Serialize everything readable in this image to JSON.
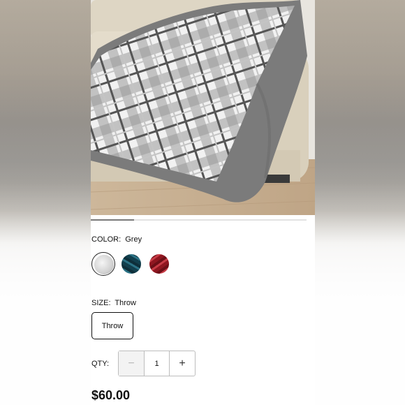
{
  "product": {
    "image_alt_icon": "blanket-photo",
    "gallery_progress": 0.2
  },
  "color": {
    "label": "COLOR:",
    "selected_value": "Grey",
    "swatches": [
      {
        "name": "grey-plaid",
        "color": "#d7d7d7",
        "selected": true
      },
      {
        "name": "teal-plaid",
        "color": "#1f5566",
        "selected": false
      },
      {
        "name": "red-plaid",
        "color": "#a5202a",
        "selected": false
      }
    ]
  },
  "size": {
    "label": "SIZE:",
    "selected_value": "Throw",
    "options": [
      "Throw"
    ]
  },
  "quantity": {
    "label": "QTY:",
    "value": "1",
    "minus_symbol": "−",
    "plus_symbol": "+"
  },
  "price": "$60.00"
}
